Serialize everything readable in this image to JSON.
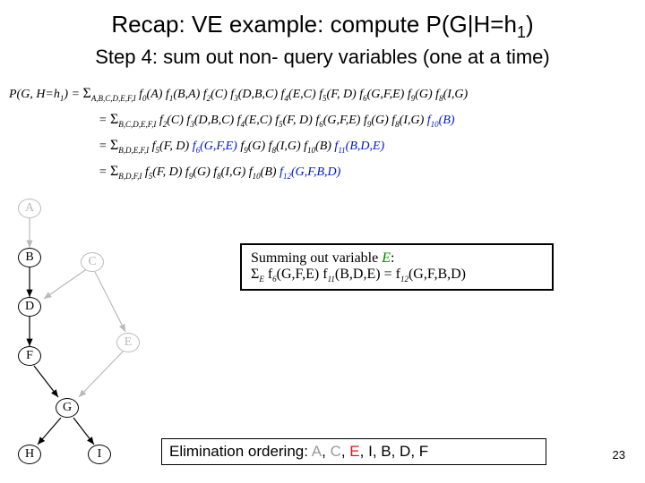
{
  "title_main": "Recap: VE example: compute ",
  "title_expr": "P(G|H=h",
  "title_sub": "1",
  "title_close": ")",
  "subtitle": "Step 4: sum out non- query variables (one at a time)",
  "eq_lhs": "P(G, H=h",
  "eq_lhs_sub": "1",
  "eq_lhs_close": ") = ",
  "sum1_sub": "A,B,C,D,E,F,I",
  "sum1_rest": " f",
  "f0s": "0",
  "f0a": "(A) f",
  "f1s": "1",
  "f1a": "(B,A) f",
  "f2s": "2",
  "f2a": "(C) f",
  "f3s": "3",
  "f3a": "(D,B,C) f",
  "f4s": "4",
  "f4a": "(E,C) f",
  "f5s": "5",
  "f5a": "(F, D) f",
  "f6s": "6",
  "f6a": "(G,F,E) f",
  "f9s": "9",
  "f9a": "(G) f",
  "f8s": "8",
  "f8a": "(I,G)",
  "eq2_pre": "= ",
  "sum2_sub": "B,C,D,E,F,I",
  "eq2_tail_a": " f",
  "eq2_2s": "2",
  "eq2_2a": "(C) f",
  "eq2_3s": "3",
  "eq2_3a": "(D,B,C) f",
  "eq2_4s": "4",
  "eq2_4a": "(E,C) f",
  "eq2_5s": "5",
  "eq2_5a": "(F, D) f",
  "eq2_6s": "6",
  "eq2_6a": "(G,F,E) f",
  "eq2_9s": "9",
  "eq2_9a": "(G) f",
  "eq2_8s": "8",
  "eq2_8a": "(I,G) ",
  "eq2_blue_f": "f",
  "eq2_blue_s": "10",
  "eq2_blue_a": "(B)",
  "eq3_pre": "= ",
  "sum3_sub": "B,D,E,F,I",
  "eq3_a": " f",
  "eq3_5s": "5",
  "eq3_5a": "(F, D) ",
  "eq3_6f": "f",
  "eq3_6s": "6",
  "eq3_6a": "(G,F,E) ",
  "eq3_9f": "f",
  "eq3_9s": "9",
  "eq3_9a": "(G) f",
  "eq3_8s": "8",
  "eq3_8a": "(I,G) f",
  "eq3_10s": "10",
  "eq3_10a": "(B) ",
  "eq3_blue_f": "f",
  "eq3_blue_s": "11",
  "eq3_blue_a": "(B,D,E)",
  "eq4_pre": "= ",
  "sum4_sub": "B,D,F,I",
  "eq4_a": " f",
  "eq4_5s": "5",
  "eq4_5a": "(F, D) f",
  "eq4_9s": "9",
  "eq4_9a": "(G) f",
  "eq4_8s": "8",
  "eq4_8a": "(I,G) f",
  "eq4_10s": "10",
  "eq4_10a": "(B) ",
  "eq4_blue_f": "f",
  "eq4_blue_s": "12",
  "eq4_blue_a": "(G,F,B,D)",
  "box_l1_a": "Summing out ",
  "box_l1_b": "variable ",
  "box_l1_E": "E",
  "box_l1_c": ":",
  "box_l2_sig": "Σ",
  "box_l2_sub": "E",
  "box_l2_a": " f",
  "box_l2_6s": "6",
  "box_l2_6a": "(G,F,E) f",
  "box_l2_11s": "11",
  "box_l2_11a": "(B,D,E) = f",
  "box_l2_12s": "12",
  "box_l2_12a": "(G,F,B,D)",
  "elim_label": "Elimination ordering: ",
  "elim_A": "A",
  "elim_s1": ", ",
  "elim_C": "C",
  "elim_s2": ", ",
  "elim_E": "E",
  "elim_s3": ", ",
  "elim_rest": "I, B, D, F",
  "page": "23",
  "nodes": {
    "A": "A",
    "B": "B",
    "C": "C",
    "D": "D",
    "E": "E",
    "F": "F",
    "G": "G",
    "H": "H",
    "I": "I"
  }
}
